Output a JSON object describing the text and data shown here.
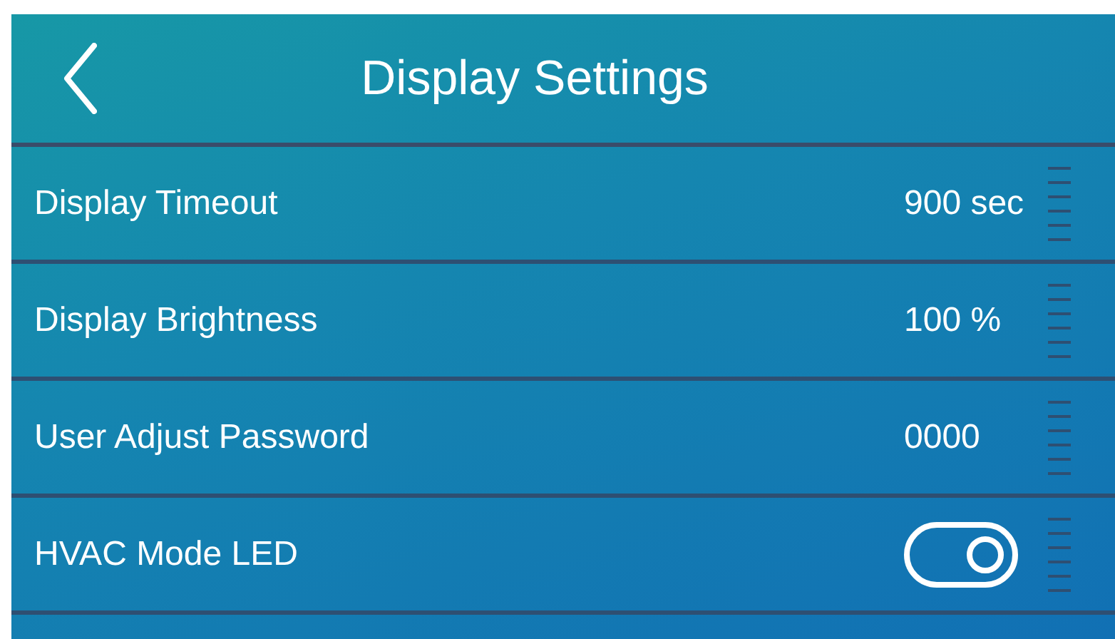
{
  "header": {
    "title": "Display Settings"
  },
  "rows": [
    {
      "kind": "value",
      "label": "Display Timeout",
      "value": "900 sec"
    },
    {
      "kind": "value",
      "label": "Display Brightness",
      "value": "100 %"
    },
    {
      "kind": "value",
      "label": "User Adjust Password",
      "value": "0000"
    },
    {
      "kind": "toggle",
      "label": "HVAC Mode LED",
      "on": true
    }
  ]
}
